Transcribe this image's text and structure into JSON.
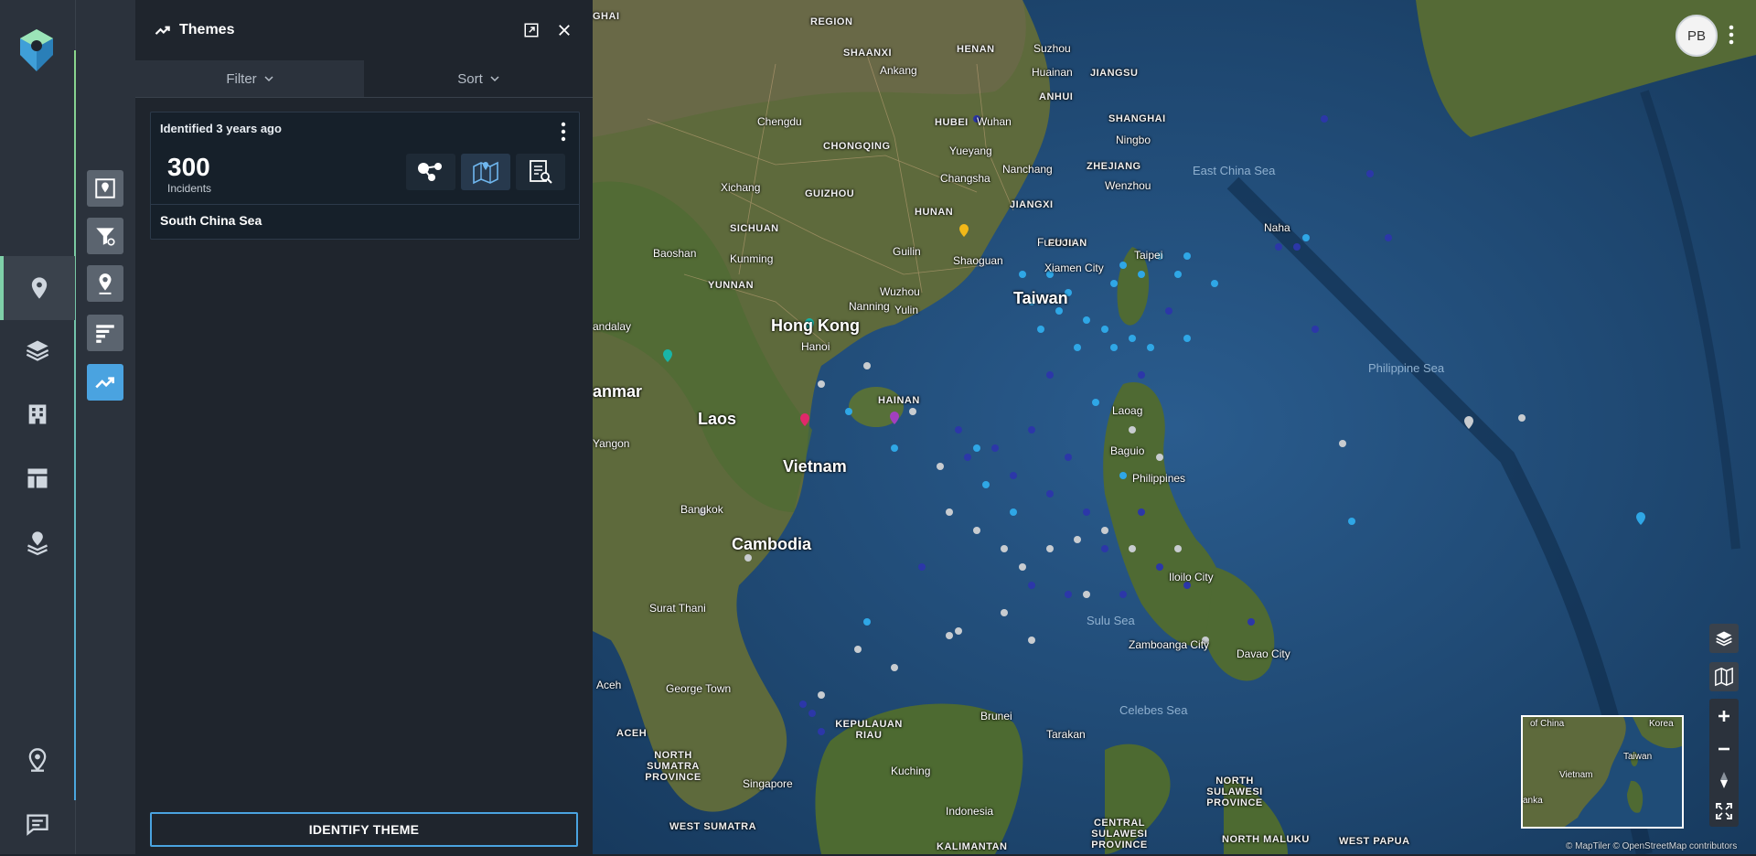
{
  "nav": {
    "items": [
      {
        "icon": "map-pin-icon",
        "active": true
      },
      {
        "icon": "layers-icon",
        "active": false
      },
      {
        "icon": "building-icon",
        "active": false
      },
      {
        "icon": "dashboard-layout-icon",
        "active": false
      },
      {
        "icon": "stacked-pin-icon",
        "active": false
      }
    ],
    "bottom": [
      {
        "icon": "location-pin-outline-icon"
      },
      {
        "icon": "feedback-icon"
      }
    ]
  },
  "tools": [
    {
      "icon": "map-search-icon",
      "active": false
    },
    {
      "icon": "filter-settings-icon",
      "active": false
    },
    {
      "icon": "pin-settings-icon",
      "active": false
    },
    {
      "icon": "bar-list-icon",
      "active": false
    },
    {
      "icon": "trend-icon",
      "active": true
    }
  ],
  "panel": {
    "title": "Themes",
    "tabs": {
      "filter": "Filter",
      "sort": "Sort"
    },
    "card": {
      "identified": "Identified 3 years ago",
      "count": "300",
      "count_label": "Incidents",
      "name": "South China Sea"
    },
    "identify_button": "IDENTIFY THEME"
  },
  "user": {
    "initials": "PB"
  },
  "map": {
    "places_large": [
      {
        "t": "Taiwan"
      },
      {
        "t": "Hong Kong"
      },
      {
        "t": "Laos"
      },
      {
        "t": "Vietnam"
      },
      {
        "t": "Cambodia"
      },
      {
        "t": "anmar"
      }
    ],
    "places_medium": [
      "Chengdu",
      "Xichang",
      "Kunming",
      "Baoshan",
      "Guilin",
      "Wuzhou",
      "Shaoguan",
      "Nanning",
      "Yulin",
      "Changsha",
      "Yueyang",
      "Wuhan",
      "Nanchang",
      "Wenzhou",
      "Ningbo",
      "Xiamen City",
      "Taipei",
      "Naha",
      "Hanoi",
      "Bangkok",
      "Surat Thani",
      "George Town",
      "Singapore",
      "Kuching",
      "Brunei",
      "Tarakan",
      "Davao City",
      "Iloilo City",
      "Zamboanga City",
      "Baguio",
      "Laoag",
      "Philippines",
      "Indonesia",
      "Yangon",
      "andalay",
      "Aceh",
      "Ankang",
      "Huainan",
      "Suzhou",
      "Fuzhou"
    ],
    "provinces": [
      "SHAANXI",
      "HENAN",
      "HUBEI",
      "ANHUI",
      "JIANGSU",
      "SHANGHAI",
      "CHONGQING",
      "ZHEJIANG",
      "SICHUAN",
      "GUIZHOU",
      "HUNAN",
      "JIANGXI",
      "FUJIAN",
      "YUNNAN",
      "HAINAN",
      "ACEH",
      "NORTH SUMATRA PROVINCE",
      "WEST SUMATRA",
      "KEPULAUAN RIAU",
      "NORTH SULAWESI PROVINCE",
      "CENTRAL SULAWESI PROVINCE",
      "NORTH MALUKU",
      "WEST PAPUA",
      "KALIMANTAN",
      "REGION",
      "GHAI"
    ],
    "seas": [
      "East China Sea",
      "Philippine Sea",
      "Sulu Sea",
      "Celebes Sea"
    ],
    "minimap_labels": [
      "of China",
      "Korea",
      "Taiwan",
      "Vietnam",
      "anka"
    ],
    "attribution": "© MapTiler © OpenStreetMap contributors"
  }
}
